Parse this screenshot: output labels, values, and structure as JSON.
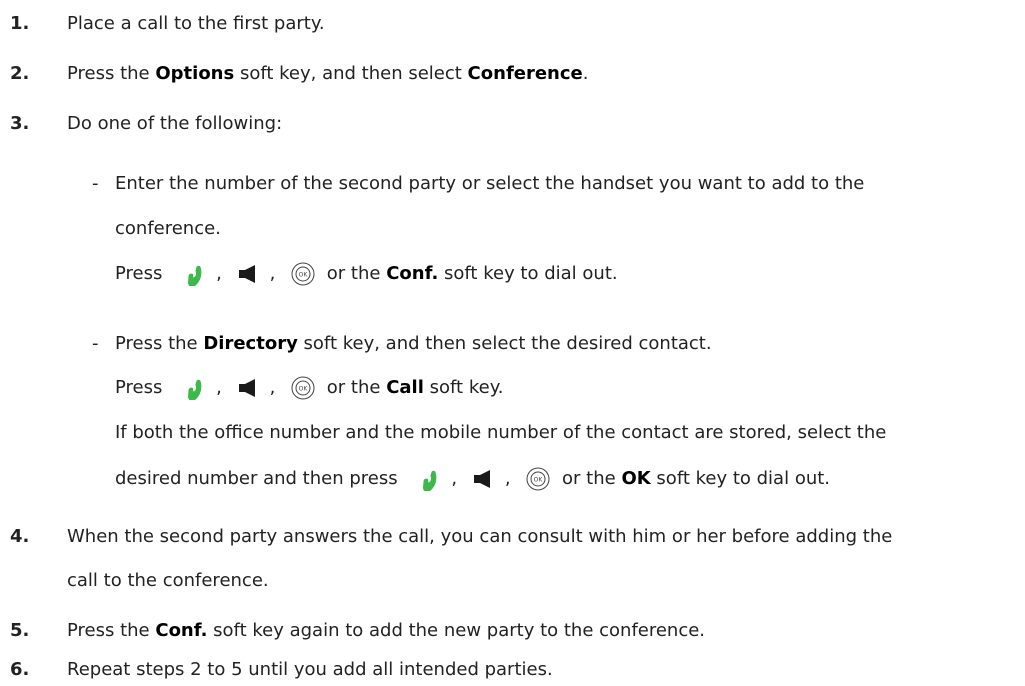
{
  "steps": [
    {
      "num": "1.",
      "text": "Place a call to the first party."
    },
    {
      "num": "2.",
      "pre": "Press the ",
      "b1": "Options",
      "mid": " soft key, and then select ",
      "b2": "Conference",
      "post": "."
    },
    {
      "num": "3.",
      "text": "Do one of the following:"
    },
    {
      "num": "4.",
      "line1": "When the second party answers the call, you can consult with him or her before adding the",
      "line2": "call to the conference."
    },
    {
      "num": "5.",
      "pre": "Press the ",
      "b": "Conf.",
      "post": " soft key again to add the new party to the conference."
    },
    {
      "num": "6.",
      "text": "Repeat steps 2 to 5 until you add all intended parties."
    }
  ],
  "options": [
    {
      "dash": "-",
      "line1": "Enter the number of the second party or select the handset you want to add to the",
      "line2": "conference.",
      "press": "Press",
      "comma": ",",
      "or_the": "or the",
      "key": "Conf.",
      "tail": "soft key to dial out."
    },
    {
      "dash": "-",
      "pre": "Press the ",
      "b": "Directory",
      "post": " soft key, and then select the desired contact.",
      "press": "Press",
      "comma": ",",
      "or_the": "or the",
      "key": "Call",
      "tail": "soft key.",
      "note_line1": "If both the office number and the mobile number of the contact are stored, select the",
      "note_line2": "desired number and then press",
      "note_or_the": "or the",
      "note_key": "OK",
      "note_tail": "soft key to dial out."
    }
  ],
  "icons": {
    "handset": "handset-icon",
    "speaker": "speaker-icon",
    "ok": "ok-key-icon"
  },
  "colors": {
    "handset": "#3db84a",
    "speaker": "#1a1a1a",
    "text": "#222222"
  }
}
